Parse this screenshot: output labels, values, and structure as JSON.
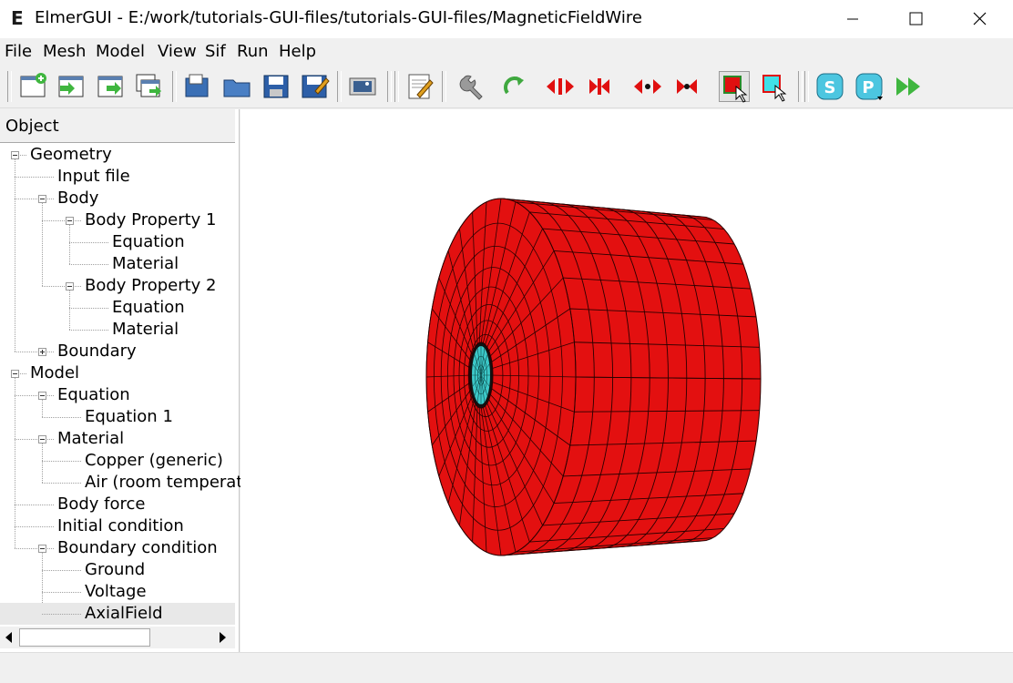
{
  "window": {
    "title": "ElmerGUI - E:/work/tutorials-GUI-files/tutorials-GUI-files/MagneticFieldWire",
    "logo": "E"
  },
  "menubar": {
    "items": [
      "File",
      "Mesh",
      "Model",
      "View",
      "Sif",
      "Run",
      "Help"
    ]
  },
  "toolbar": {
    "icons": [
      "new-file-icon",
      "open-file-icon",
      "load-mesh-icon",
      "import-icon",
      "copy-document-icon",
      "open-folder-icon",
      "save-icon",
      "save-as-icon",
      "screenshot-icon",
      "edit-sif-icon",
      "settings-wrench-icon",
      "generate-mesh-icon",
      "unify-surface-icon",
      "divide-surface-icon",
      "unify-edge-icon",
      "divide-edge-icon",
      "select-surface-icon",
      "select-edge-icon",
      "start-solver-icon",
      "start-postprocessor-icon",
      "run-all-icon"
    ]
  },
  "colors": {
    "mesh_surface": "#e31010",
    "mesh_lines": "#2a0000",
    "inner_conductor": "#3cc8c8",
    "selected_row": "#e8e8e8"
  },
  "object_panel": {
    "header": "Object",
    "tree": [
      {
        "label": "Geometry",
        "level": 0,
        "expanded": true
      },
      {
        "label": "Input file",
        "level": 1
      },
      {
        "label": "Body",
        "level": 1,
        "expanded": true
      },
      {
        "label": "Body Property 1",
        "level": 2,
        "expanded": true
      },
      {
        "label": "Equation",
        "level": 3
      },
      {
        "label": "Material",
        "level": 3
      },
      {
        "label": "Body Property 2",
        "level": 2,
        "expanded": true
      },
      {
        "label": "Equation",
        "level": 3
      },
      {
        "label": "Material",
        "level": 3
      },
      {
        "label": "Boundary",
        "level": 1,
        "expanded": false
      },
      {
        "label": "Model",
        "level": 0,
        "expanded": true
      },
      {
        "label": "Equation",
        "level": 1,
        "expanded": true
      },
      {
        "label": "Equation 1",
        "level": 2
      },
      {
        "label": "Material",
        "level": 1,
        "expanded": true
      },
      {
        "label": "Copper (generic)",
        "level": 2
      },
      {
        "label": "Air (room temperat",
        "level": 2
      },
      {
        "label": "Body force",
        "level": 1
      },
      {
        "label": "Initial condition",
        "level": 1
      },
      {
        "label": "Boundary condition",
        "level": 1,
        "expanded": true
      },
      {
        "label": "Ground",
        "level": 2
      },
      {
        "label": "Voltage",
        "level": 2
      },
      {
        "label": "AxialField",
        "level": 2,
        "selected": true
      }
    ]
  }
}
